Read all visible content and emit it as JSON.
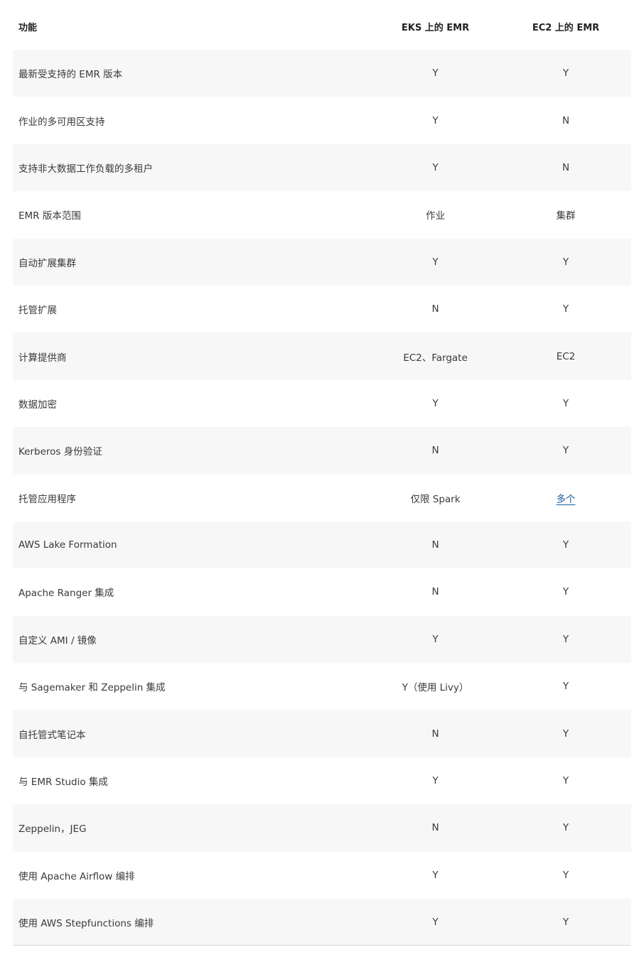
{
  "table": {
    "headers": {
      "feature": "功能",
      "eks": "EKS 上的 EMR",
      "ec2": "EC2 上的 EMR"
    },
    "rows": [
      {
        "feature": "最新受支持的 EMR 版本",
        "eks": "Y",
        "ec2": "Y"
      },
      {
        "feature": "作业的多可用区支持",
        "eks": "Y",
        "ec2": "N"
      },
      {
        "feature": "支持非大数据工作负载的多租户",
        "eks": "Y",
        "ec2": "N"
      },
      {
        "feature": "EMR 版本范围",
        "eks": "作业",
        "ec2": "集群"
      },
      {
        "feature": "自动扩展集群",
        "eks": "Y",
        "ec2": "Y"
      },
      {
        "feature": "托管扩展",
        "eks": "N",
        "ec2": "Y"
      },
      {
        "feature": "计算提供商",
        "eks": "EC2、Fargate",
        "ec2": "EC2"
      },
      {
        "feature": "数据加密",
        "eks": "Y",
        "ec2": "Y"
      },
      {
        "feature": "Kerberos 身份验证",
        "eks": "N",
        "ec2": "Y"
      },
      {
        "feature": "托管应用程序",
        "eks": "仅限 Spark",
        "ec2": "多个",
        "ec2_is_link": true
      },
      {
        "feature": "AWS Lake Formation",
        "eks": "N",
        "ec2": "Y"
      },
      {
        "feature": "Apache Ranger 集成",
        "eks": "N",
        "ec2": "Y"
      },
      {
        "feature": "自定义 AMI / 镜像",
        "eks": "Y",
        "ec2": "Y"
      },
      {
        "feature": "与 Sagemaker 和 Zeppelin 集成",
        "eks": "Y（使用 Livy）",
        "ec2": "Y"
      },
      {
        "feature": "自托管式笔记本",
        "eks": "N",
        "ec2": "Y"
      },
      {
        "feature": "与 EMR Studio 集成",
        "eks": "Y",
        "ec2": "Y"
      },
      {
        "feature": "Zeppelin，JEG",
        "eks": "N",
        "ec2": "Y"
      },
      {
        "feature": "使用 Apache Airflow 编排",
        "eks": "Y",
        "ec2": "Y"
      },
      {
        "feature": "使用 AWS Stepfunctions 编排",
        "eks": "Y",
        "ec2": "Y"
      }
    ]
  },
  "colors": {
    "row_shade": "#f7f7f7",
    "link": "#1a5c9e",
    "text": "#3a3a3a"
  }
}
